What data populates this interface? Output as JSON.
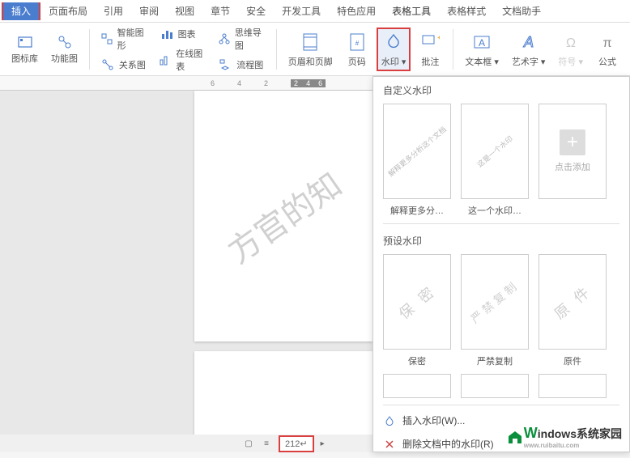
{
  "tabs": {
    "insert": "插入",
    "page_layout": "页面布局",
    "reference": "引用",
    "review": "审阅",
    "view": "视图",
    "chapter": "章节",
    "security": "安全",
    "dev_tools": "开发工具",
    "special_app": "特色应用",
    "table_tools": "表格工具",
    "table_style": "表格样式",
    "doc_helper": "文档助手"
  },
  "ribbon": {
    "icon_lib": "图标库",
    "func_chart": "功能图",
    "smart_graphic": "智能图形",
    "relation_chart": "关系图",
    "chart": "图表",
    "online_chart": "在线图表",
    "mind_map": "思维导图",
    "flowchart": "流程图",
    "header_footer": "页眉和页脚",
    "page_num": "页码",
    "watermark": "水印",
    "comment": "批注",
    "textbox": "文本框",
    "art_text": "艺术字",
    "symbol": "符号",
    "formula": "公式"
  },
  "ruler": [
    "6",
    "4",
    "2",
    "2",
    "4",
    "6"
  ],
  "page": {
    "watermark_text": "方官的知",
    "page_num": "212"
  },
  "dropdown": {
    "custom_title": "自定义水印",
    "preset_title": "预设水印",
    "custom_items": [
      {
        "label": "解释更多分…",
        "wm": "解释更多分析这个文档"
      },
      {
        "label": "这一个水印…",
        "wm": "这是一个水印"
      },
      {
        "label": "点击添加",
        "is_add": true
      }
    ],
    "preset_items": [
      {
        "label": "保密",
        "wm": "保 密"
      },
      {
        "label": "严禁复制",
        "wm": "严禁复制"
      },
      {
        "label": "原件",
        "wm": "原 件"
      }
    ],
    "menu_insert": "插入水印(W)...",
    "menu_delete": "删除文档中的水印(R)"
  },
  "brand": {
    "w": "W",
    "text": "indows系统家园",
    "sub": "www.ruibaitu.com"
  }
}
